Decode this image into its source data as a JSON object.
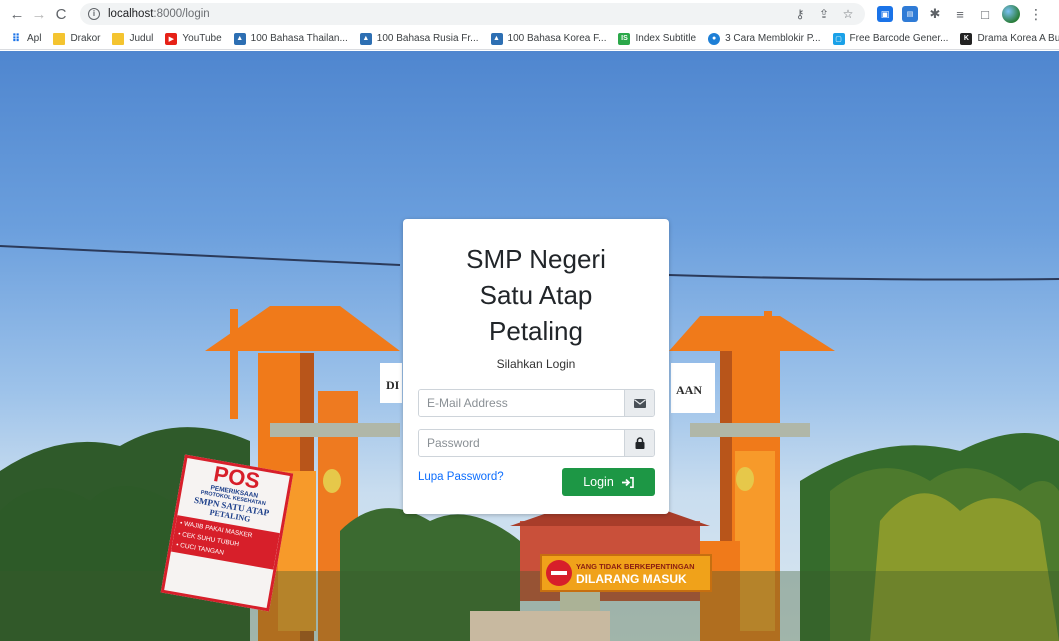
{
  "browser": {
    "url_host": "localhost",
    "url_rest": ":8000/login",
    "bookmarks": [
      {
        "label": "Apl",
        "icon": "apps-grid-icon"
      },
      {
        "label": "Drakor",
        "icon": "folder-icon"
      },
      {
        "label": "Judul",
        "icon": "folder-icon"
      },
      {
        "label": "YouTube",
        "icon": "youtube-icon"
      },
      {
        "label": "100 Bahasa Thailan...",
        "icon": "image-icon"
      },
      {
        "label": "100 Bahasa Rusia Fr...",
        "icon": "image-icon"
      },
      {
        "label": "100 Bahasa Korea F...",
        "icon": "image-icon"
      },
      {
        "label": "Index Subtitle",
        "icon": "is-icon"
      },
      {
        "label": "3 Cara Memblokir P...",
        "icon": "globe-icon"
      },
      {
        "label": "Free Barcode Gener...",
        "icon": "barcode-icon"
      },
      {
        "label": "Drama Korea A Busi...",
        "icon": "k-icon"
      }
    ],
    "more_bookmarks": "»"
  },
  "background": {
    "pos_sign": [
      "POS",
      "PEMERIKSAAN",
      "PROTOKOL KESEHATAN",
      "SMPN SATU ATAP",
      "PETALING",
      "• WAJIB PAKAI MASKER",
      "• CEK SUHU TUBUH",
      "• CUCI TANGAN"
    ],
    "warning_sign": [
      "YANG TIDAK BERKEPENTINGAN",
      "DILARANG MASUK"
    ],
    "gate_left_text": "DI",
    "gate_right_text": "AAN"
  },
  "login": {
    "title_line1": "SMP Negeri",
    "title_line2": "Satu Atap",
    "title_line3": "Petaling",
    "subtitle": "Silahkan Login",
    "email_placeholder": "E-Mail Address",
    "password_placeholder": "Password",
    "forgot_label": "Lupa Password?",
    "login_label": "Login"
  },
  "colors": {
    "login_button": "#1d9745",
    "link": "#0d6efd",
    "gate_orange": "#f07a1a"
  }
}
